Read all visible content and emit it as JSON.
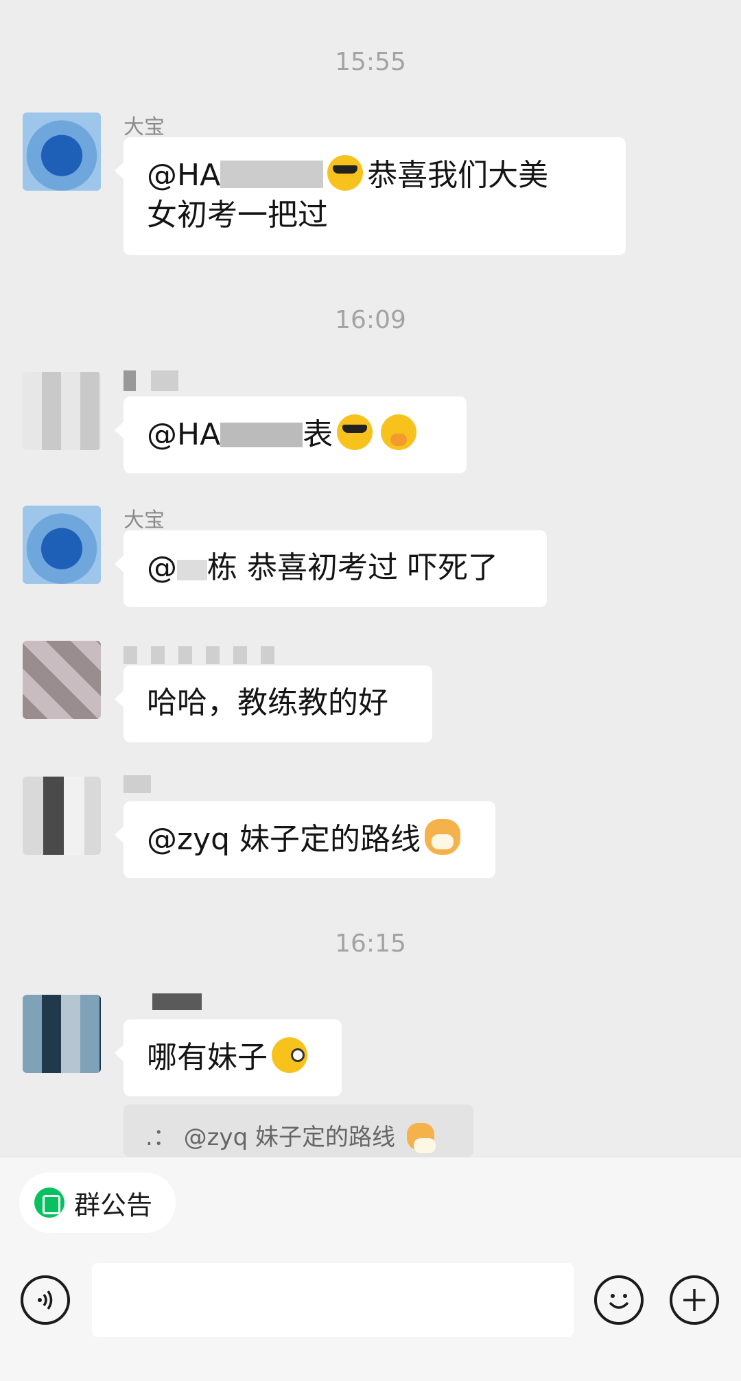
{
  "timestamps": [
    "15:55",
    "16:09",
    "16:15"
  ],
  "messages": [
    {
      "sender": "大宝",
      "text_prefix": "@HA",
      "text_suffix": "恭喜我们大美",
      "text_line2": "女初考一把过",
      "emojis": [
        "cool-emoji"
      ]
    },
    {
      "sender": "",
      "text_prefix": "@HA",
      "text_suffix": "表",
      "emojis": [
        "cool-emoji",
        "shy-emoji"
      ]
    },
    {
      "sender": "大宝",
      "text_prefix": "@",
      "text_suffix": "栋 恭喜初考过 吓死了"
    },
    {
      "sender": "",
      "text": "哈哈，教练教的好"
    },
    {
      "sender": "",
      "text": "@zyq 妹子定的路线",
      "emojis": [
        "cat-emoji"
      ]
    },
    {
      "sender": "",
      "text": "哪有妹子",
      "emojis": [
        "wink-emoji"
      ]
    }
  ],
  "quote": {
    "prefix": ".：",
    "text": "@zyq 妹子定的路线"
  },
  "bottom_bar": {
    "notice_label": "群公告",
    "voice_icon": "voice-icon",
    "emoji_icon": "emoji-icon",
    "plus_icon": "plus-icon"
  },
  "colors": {
    "background": "#ededed",
    "bubble": "#ffffff",
    "accent": "#07c160"
  }
}
